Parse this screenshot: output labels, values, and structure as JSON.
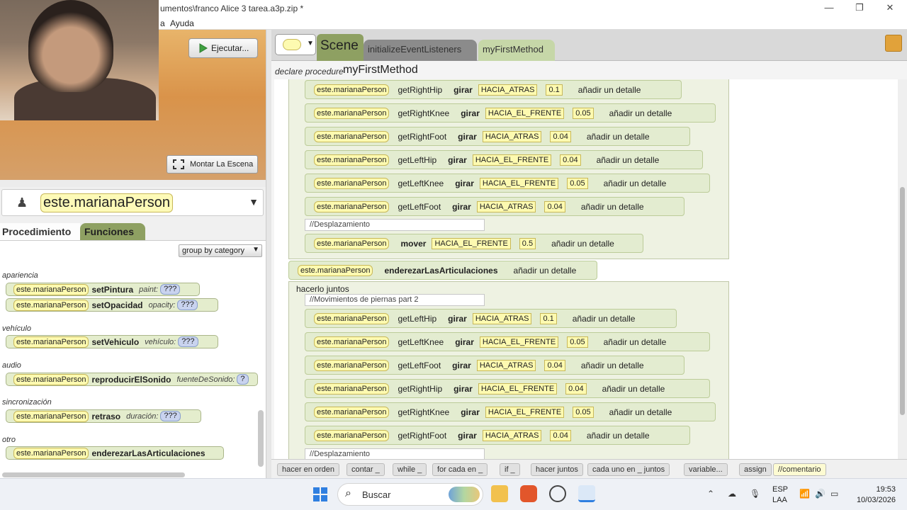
{
  "window": {
    "title": "umentos\\franco Alice 3 tarea.a3p.zip *",
    "minimize": "—",
    "maximize": "❐",
    "close": "✕"
  },
  "menu": {
    "items": [
      "a",
      "Ayuda"
    ]
  },
  "scene": {
    "run_label": "Ejecutar...",
    "setup_label": "Montar La Escena"
  },
  "selector": {
    "object_name": "este.marianaPerson"
  },
  "left_tabs": {
    "procedures": "Procedimiento",
    "functions": "Funciones"
  },
  "group_by": {
    "value": "group by category"
  },
  "categories": [
    {
      "label": "apariencia"
    },
    {
      "label": "vehículo"
    },
    {
      "label": "audio"
    },
    {
      "label": "sincronización"
    },
    {
      "label": "otro"
    }
  ],
  "tiles": [
    {
      "obj": "este.marianaPerson",
      "method": "setPintura",
      "param": "paint: ",
      "q": "???"
    },
    {
      "obj": "este.marianaPerson",
      "method": "setOpacidad",
      "param": "opacity: ",
      "q": "???"
    },
    {
      "obj": "este.marianaPerson",
      "method": "setVehiculo",
      "param": "vehículo: ",
      "q": "???"
    },
    {
      "obj": "este.marianaPerson",
      "method": "reproducirElSonido",
      "param": "fuenteDeSonido: ",
      "q": "?"
    },
    {
      "obj": "este.marianaPerson",
      "method": "retraso",
      "param": "duración: ",
      "q": "???"
    },
    {
      "obj": "este.marianaPerson",
      "method": "enderezarLasArticulaciones",
      "param": "",
      "q": ""
    }
  ],
  "editor": {
    "tab_scene": "Scene",
    "tab_init": "initializeEventListeners",
    "tab_method": "myFirstMethod",
    "declare_keyword": "declare procedure",
    "method_name": "myFirstMethod"
  },
  "statements_top": [
    {
      "obj": "este.marianaPerson",
      "joint": "getRightHip",
      "verb": "girar",
      "dir": "HACIA_ATRAS",
      "num": "0.1",
      "detail": "añadir un detalle"
    },
    {
      "obj": "este.marianaPerson",
      "joint": "getRightKnee",
      "verb": "girar",
      "dir": "HACIA_EL_FRENTE",
      "num": "0.05",
      "detail": "añadir un detalle"
    },
    {
      "obj": "este.marianaPerson",
      "joint": "getRightFoot",
      "verb": "girar",
      "dir": "HACIA_ATRAS",
      "num": "0.04",
      "detail": "añadir un detalle"
    },
    {
      "obj": "este.marianaPerson",
      "joint": "getLeftHip",
      "verb": "girar",
      "dir": "HACIA_EL_FRENTE",
      "num": "0.04",
      "detail": "añadir un detalle"
    },
    {
      "obj": "este.marianaPerson",
      "joint": "getLeftKnee",
      "verb": "girar",
      "dir": "HACIA_EL_FRENTE",
      "num": "0.05",
      "detail": "añadir un detalle"
    },
    {
      "obj": "este.marianaPerson",
      "joint": "getLeftFoot",
      "verb": "girar",
      "dir": "HACIA_ATRAS",
      "num": "0.04",
      "detail": "añadir un detalle"
    }
  ],
  "comment1": "//Desplazamiento",
  "move_stmt": {
    "obj": "este.marianaPerson",
    "verb": "mover",
    "dir": "HACIA_EL_FRENTE",
    "num": "0.5",
    "detail": "añadir un detalle"
  },
  "straighten_stmt": {
    "obj": "este.marianaPerson",
    "verb": "enderezarLasArticulaciones",
    "detail": "añadir un detalle"
  },
  "do_together_label": "hacerlo juntos",
  "comment2": "//Movimientos de piernas part 2",
  "statements_bottom": [
    {
      "obj": "este.marianaPerson",
      "joint": "getLeftHip",
      "verb": "girar",
      "dir": "HACIA_ATRAS",
      "num": "0.1",
      "detail": "añadir un detalle"
    },
    {
      "obj": "este.marianaPerson",
      "joint": "getLeftKnee",
      "verb": "girar",
      "dir": "HACIA_EL_FRENTE",
      "num": "0.05",
      "detail": "añadir un detalle"
    },
    {
      "obj": "este.marianaPerson",
      "joint": "getLeftFoot",
      "verb": "girar",
      "dir": "HACIA_ATRAS",
      "num": "0.04",
      "detail": "añadir un detalle"
    },
    {
      "obj": "este.marianaPerson",
      "joint": "getRightHip",
      "verb": "girar",
      "dir": "HACIA_EL_FRENTE",
      "num": "0.04",
      "detail": "añadir un detalle"
    },
    {
      "obj": "este.marianaPerson",
      "joint": "getRightKnee",
      "verb": "girar",
      "dir": "HACIA_EL_FRENTE",
      "num": "0.05",
      "detail": "añadir un detalle"
    },
    {
      "obj": "este.marianaPerson",
      "joint": "getRightFoot",
      "verb": "girar",
      "dir": "HACIA_ATRAS",
      "num": "0.04",
      "detail": "añadir un detalle"
    }
  ],
  "comment3": "//Desplazamiento",
  "snippets": [
    "hacer en orden",
    "contar _",
    "while _",
    "for cada en _",
    "if _",
    "hacer juntos",
    "cada uno en _ juntos",
    "variable...",
    "assign",
    "//comentario"
  ],
  "taskbar": {
    "search_placeholder": "Buscar",
    "lang1": "ESP",
    "lang2": "LAA",
    "time": "19:53",
    "date": "10/03/2026"
  },
  "colors": {
    "accent_green": "#8ea062",
    "object_yellow": "#fdfab0",
    "statement_bg": "#e3ecd0"
  }
}
